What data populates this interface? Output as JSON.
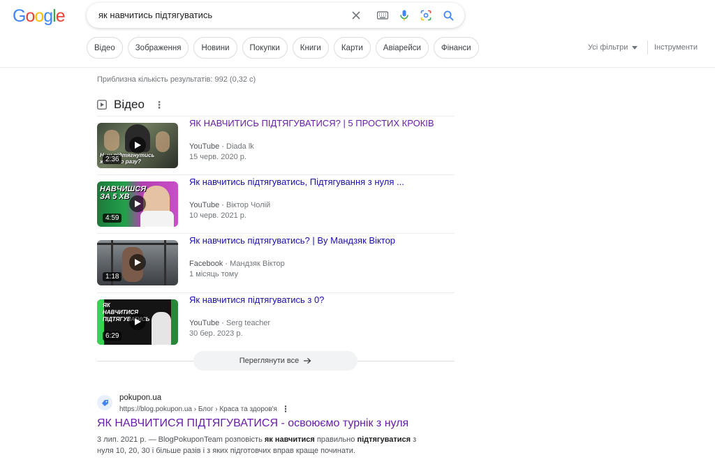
{
  "logo": {
    "text": "Google"
  },
  "search": {
    "query": "як навчитись підтягуватись"
  },
  "filters": {
    "chips": [
      "Відео",
      "Зображення",
      "Новини",
      "Покупки",
      "Книги",
      "Карти",
      "Авіарейси",
      "Фінанси"
    ],
    "all_filters": "Усі фільтри",
    "tools": "Інструменти"
  },
  "result_stats": "Приблизна кількість результатів: 992 (0,32 с)",
  "videos": {
    "heading": "Відео",
    "items": [
      {
        "title": "ЯК НАВЧИТИСЬ ПІДТЯГУВАТИСЯ? | 5 ПРОСТИХ КРОКІВ",
        "source": "YouTube",
        "channel": "Diada lk",
        "date": "15 черв. 2020 р.",
        "duration": "2:36",
        "caption": "Н_ш підтягнутись жодного разу?"
      },
      {
        "title": "Як навчитись підтягуватись, Підтягування з нуля ...",
        "source": "YouTube",
        "channel": "Віктор Чолій",
        "date": "10 черв. 2021 р.",
        "duration": "4:59",
        "caption": "НАВЧИШСЯ ЗА 5 ХВ"
      },
      {
        "title": "Як навчитись підтягуватись? | By Мандзяк Віктор",
        "source": "Facebook",
        "channel": "Мандзяк Віктор",
        "date": "1 місяць тому",
        "duration": "1:18",
        "caption": ""
      },
      {
        "title": "Як навчитися підтягуватись з 0?",
        "source": "YouTube",
        "channel": "Serg teacher",
        "date": "30 бер. 2023 р.",
        "duration": "6:29",
        "caption": "ЯК НАВЧИТИСЯ ПІДТЯГУВАТИСЬ"
      }
    ],
    "view_all": "Переглянути все"
  },
  "web_result": {
    "site_name": "pokupon.ua",
    "url": "https://blog.pokupon.ua › Блог › Краса та здоров'я",
    "title": "ЯК НАВЧИТИСЯ ПІДТЯГУВАТИСЯ - освоюємо турнік з нуля",
    "snippet_date": "3 лип. 2021 р.",
    "snippet_p1": " — BlogPokuponTeam розповість ",
    "snippet_b1": "як навчитися",
    "snippet_p2": " правильно ",
    "snippet_b2": "підтягуватися",
    "snippet_p3": " з нуля 10, 20, 30 і більше разів і з яких підготовчих вправ краще починати."
  },
  "colors": {
    "link": "#1a0dab",
    "visited": "#681da8",
    "logo_blue": "#4285f4",
    "logo_red": "#ea4335",
    "logo_yellow": "#fbbc05",
    "logo_green": "#34a853"
  }
}
